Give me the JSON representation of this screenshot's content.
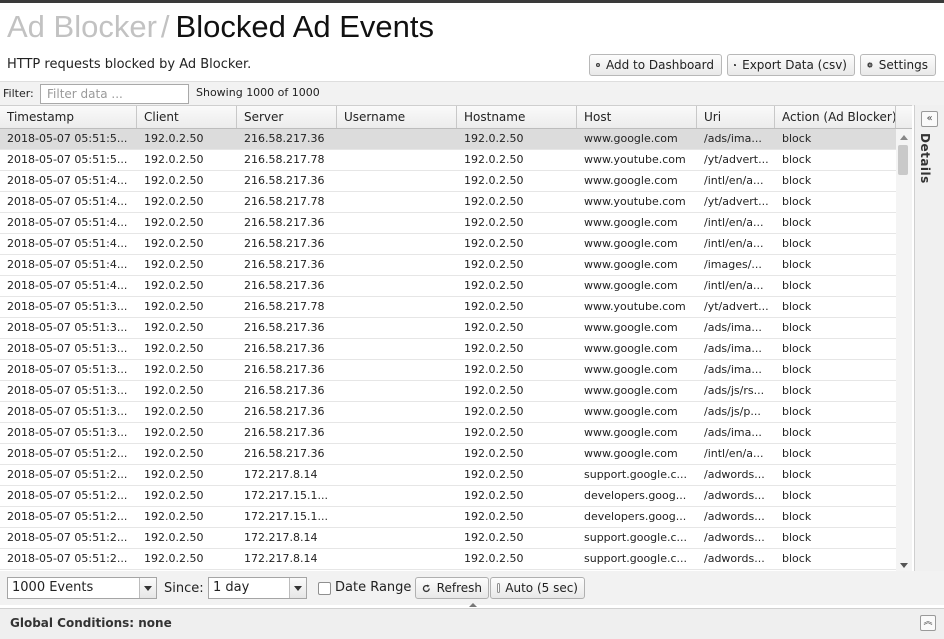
{
  "header": {
    "breadcrumb": "Ad Blocker",
    "separator": "/",
    "title": "Blocked Ad Events",
    "subtitle": "HTTP requests blocked by Ad Blocker."
  },
  "toolbar": {
    "add_dashboard": "Add to Dashboard",
    "export": "Export Data (csv)",
    "settings": "Settings"
  },
  "filter": {
    "label": "Filter:",
    "placeholder": "Filter data ...",
    "showing": "Showing 1000 of 1000"
  },
  "table": {
    "columns": [
      "Timestamp",
      "Client",
      "Server",
      "Username",
      "Hostname",
      "Host",
      "Uri",
      "Action (Ad Blocker)"
    ],
    "rows": [
      [
        "2018-05-07 05:51:5...",
        "192.0.2.50",
        "216.58.217.36",
        "",
        "192.0.2.50",
        "www.google.com",
        "/ads/ima...",
        "block"
      ],
      [
        "2018-05-07 05:51:5...",
        "192.0.2.50",
        "216.58.217.78",
        "",
        "192.0.2.50",
        "www.youtube.com",
        "/yt/advert...",
        "block"
      ],
      [
        "2018-05-07 05:51:4...",
        "192.0.2.50",
        "216.58.217.36",
        "",
        "192.0.2.50",
        "www.google.com",
        "/intl/en/a...",
        "block"
      ],
      [
        "2018-05-07 05:51:4...",
        "192.0.2.50",
        "216.58.217.78",
        "",
        "192.0.2.50",
        "www.youtube.com",
        "/yt/advert...",
        "block"
      ],
      [
        "2018-05-07 05:51:4...",
        "192.0.2.50",
        "216.58.217.36",
        "",
        "192.0.2.50",
        "www.google.com",
        "/intl/en/a...",
        "block"
      ],
      [
        "2018-05-07 05:51:4...",
        "192.0.2.50",
        "216.58.217.36",
        "",
        "192.0.2.50",
        "www.google.com",
        "/intl/en/a...",
        "block"
      ],
      [
        "2018-05-07 05:51:4...",
        "192.0.2.50",
        "216.58.217.36",
        "",
        "192.0.2.50",
        "www.google.com",
        "/images/...",
        "block"
      ],
      [
        "2018-05-07 05:51:4...",
        "192.0.2.50",
        "216.58.217.36",
        "",
        "192.0.2.50",
        "www.google.com",
        "/intl/en/a...",
        "block"
      ],
      [
        "2018-05-07 05:51:3...",
        "192.0.2.50",
        "216.58.217.78",
        "",
        "192.0.2.50",
        "www.youtube.com",
        "/yt/advert...",
        "block"
      ],
      [
        "2018-05-07 05:51:3...",
        "192.0.2.50",
        "216.58.217.36",
        "",
        "192.0.2.50",
        "www.google.com",
        "/ads/ima...",
        "block"
      ],
      [
        "2018-05-07 05:51:3...",
        "192.0.2.50",
        "216.58.217.36",
        "",
        "192.0.2.50",
        "www.google.com",
        "/ads/ima...",
        "block"
      ],
      [
        "2018-05-07 05:51:3...",
        "192.0.2.50",
        "216.58.217.36",
        "",
        "192.0.2.50",
        "www.google.com",
        "/ads/ima...",
        "block"
      ],
      [
        "2018-05-07 05:51:3...",
        "192.0.2.50",
        "216.58.217.36",
        "",
        "192.0.2.50",
        "www.google.com",
        "/ads/js/rs...",
        "block"
      ],
      [
        "2018-05-07 05:51:3...",
        "192.0.2.50",
        "216.58.217.36",
        "",
        "192.0.2.50",
        "www.google.com",
        "/ads/js/p...",
        "block"
      ],
      [
        "2018-05-07 05:51:3...",
        "192.0.2.50",
        "216.58.217.36",
        "",
        "192.0.2.50",
        "www.google.com",
        "/ads/ima...",
        "block"
      ],
      [
        "2018-05-07 05:51:2...",
        "192.0.2.50",
        "216.58.217.36",
        "",
        "192.0.2.50",
        "www.google.com",
        "/intl/en/a...",
        "block"
      ],
      [
        "2018-05-07 05:51:2...",
        "192.0.2.50",
        "172.217.8.14",
        "",
        "192.0.2.50",
        "support.google.c...",
        "/adwords...",
        "block"
      ],
      [
        "2018-05-07 05:51:2...",
        "192.0.2.50",
        "172.217.15.1...",
        "",
        "192.0.2.50",
        "developers.goog...",
        "/adwords...",
        "block"
      ],
      [
        "2018-05-07 05:51:2...",
        "192.0.2.50",
        "172.217.15.1...",
        "",
        "192.0.2.50",
        "developers.goog...",
        "/adwords...",
        "block"
      ],
      [
        "2018-05-07 05:51:2...",
        "192.0.2.50",
        "172.217.8.14",
        "",
        "192.0.2.50",
        "support.google.c...",
        "/adwords...",
        "block"
      ],
      [
        "2018-05-07 05:51:2...",
        "192.0.2.50",
        "172.217.8.14",
        "",
        "192.0.2.50",
        "support.google.c...",
        "/adwords...",
        "block"
      ]
    ]
  },
  "details": {
    "label": "Details"
  },
  "footer": {
    "events_select": "1000 Events",
    "since_label": "Since:",
    "since_select": "1 day",
    "date_range": "Date Range",
    "refresh": "Refresh",
    "auto": "Auto (5 sec)"
  },
  "global": {
    "text": "Global Conditions: none"
  },
  "colors": {
    "selected_row": "#dcdcdc",
    "breadcrumb": "#c2c2c2"
  },
  "icons": {
    "add_dashboard": "plus-circle-icon",
    "export": "export-icon",
    "settings": "gear-icon",
    "refresh": "refresh-icon",
    "details_toggle": "double-chevron-left-icon",
    "global_toggle": "double-chevron-up-icon"
  }
}
